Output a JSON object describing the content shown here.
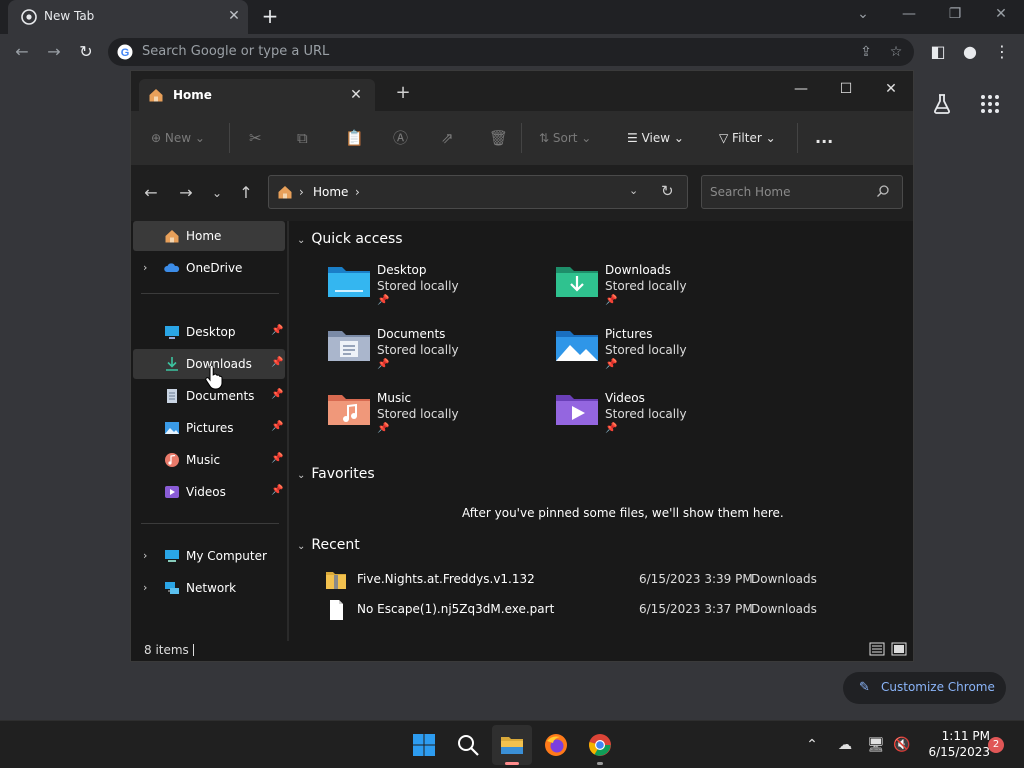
{
  "chrome": {
    "tab_title": "New Tab",
    "omnibox_placeholder": "Search Google or type a URL",
    "customize_label": "Customize Chrome"
  },
  "explorer": {
    "tab_title": "Home",
    "toolbar": {
      "new_label": "New",
      "sort_label": "Sort",
      "view_label": "View",
      "filter_label": "Filter",
      "more_label": "..."
    },
    "address": {
      "crumb": "Home",
      "search_placeholder": "Search Home"
    },
    "nav": {
      "home": "Home",
      "onedrive": "OneDrive",
      "desktop": "Desktop",
      "downloads": "Downloads",
      "documents": "Documents",
      "pictures": "Pictures",
      "music": "Music",
      "videos": "Videos",
      "my_computer": "My Computer",
      "network": "Network"
    },
    "quick_access": {
      "heading": "Quick access",
      "items": [
        {
          "name": "Desktop",
          "sub": "Stored locally"
        },
        {
          "name": "Downloads",
          "sub": "Stored locally"
        },
        {
          "name": "Documents",
          "sub": "Stored locally"
        },
        {
          "name": "Pictures",
          "sub": "Stored locally"
        },
        {
          "name": "Music",
          "sub": "Stored locally"
        },
        {
          "name": "Videos",
          "sub": "Stored locally"
        }
      ]
    },
    "favorites": {
      "heading": "Favorites",
      "empty_text": "After you've pinned some files, we'll show them here."
    },
    "recent": {
      "heading": "Recent",
      "rows": [
        {
          "name": "Five.Nights.at.Freddys.v1.132",
          "date": "6/15/2023 3:39 PM",
          "location": "Downloads"
        },
        {
          "name": "No Escape(1).nj5Zq3dM.exe.part",
          "date": "6/15/2023 3:37 PM",
          "location": "Downloads"
        }
      ]
    },
    "status": {
      "items_count": "8 items"
    }
  },
  "taskbar": {
    "time": "1:11 PM",
    "date": "6/15/2023",
    "notification_count": "2"
  },
  "colors": {
    "accent_blue": "#8ab4f8",
    "folder_yellow": "#f2c14e",
    "notification_red": "#e05656"
  }
}
